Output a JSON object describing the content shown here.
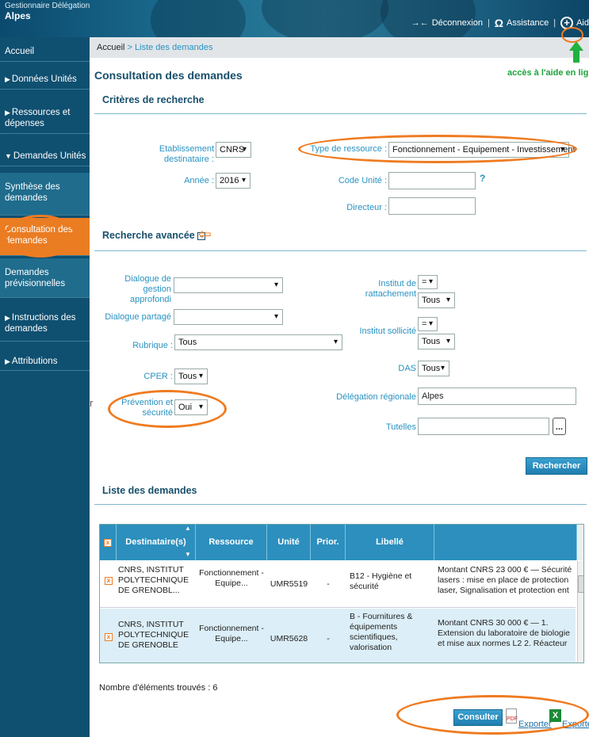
{
  "header": {
    "org_title": "Gestionnaire Délégation",
    "org_name": "Alpes",
    "logout_label": "Déconnexion",
    "assistance_label": "Assistance",
    "help_label": "Aid"
  },
  "sidebar": {
    "items": [
      {
        "label": "Accueil"
      },
      {
        "label": "Données Unités"
      },
      {
        "label": "Ressources et dépenses"
      },
      {
        "label": "Demandes Unités"
      },
      {
        "label": "Synthèse des demandes"
      },
      {
        "label": "Consultation des demandes"
      },
      {
        "label": "Demandes prévisionnelles"
      },
      {
        "label": "Instructions des demandes"
      },
      {
        "label": "Attributions"
      }
    ]
  },
  "breadcrumb": {
    "home": "Accueil",
    "sep": " > ",
    "current": "Liste des demandes"
  },
  "page_title": "Consultation des demandes",
  "help_note": "accès à l'aide en ligne",
  "criteria": {
    "title": "Critères de recherche",
    "etab_label": "Etablissement destinataire :",
    "etab_value": "CNRS",
    "type_label": "Type de ressource :",
    "type_value": "Fonctionnement - Equipement - Investissement",
    "annee_label": "Année :",
    "annee_value": "2016",
    "code_label": "Code Unité :",
    "code_value": "",
    "directeur_label": "Directeur :",
    "directeur_value": ""
  },
  "advanced": {
    "title": "Recherche avancée",
    "toggle": "−",
    "dialogue_gestion_label": "Dialogue de gestion approfondi",
    "dialogue_partage_label": "Dialogue partagé",
    "rubrique_label": "Rubrique :",
    "rubrique_value": "Tous",
    "cper_label": "CPER :",
    "cper_value": "Tous",
    "prevention_label": "Prévention et sécurité",
    "prevention_value": "Oui",
    "institut_ratt_label": "Institut de rattachement",
    "institut_ratt_op": "=",
    "institut_ratt_value": "Tous",
    "institut_soll_label": "Institut sollicité",
    "institut_soll_op": "=",
    "institut_soll_value": "Tous",
    "das_label": "DAS",
    "das_value": "Tous",
    "delegation_label": "Délégation régionale",
    "delegation_value": "Alpes",
    "tutelles_label": "Tutelles",
    "tutelles_btn": "...",
    "search_button": "Rechercher"
  },
  "list": {
    "title": "Liste des demandes",
    "columns": [
      "Destinataire(s)",
      "Ressource",
      "Unité",
      "Prior.",
      "Libellé",
      ""
    ],
    "rows": [
      {
        "dest": "CNRS, INSTITUT POLYTECHNIQUE DE GRENOBL...",
        "res": "Fonctionnement - Equipe...",
        "unit": "UMR5519",
        "prior": "-",
        "libelle": "B12 - Hygiène et sécurité",
        "desc": "Montant CNRS 23 000 € — Sécurité lasers : mise en place de protection laser, Signalisation et protection ent"
      },
      {
        "dest": "CNRS, INSTITUT POLYTECHNIQUE DE GRENOBLE",
        "res": "Fonctionnement - Equipe...",
        "unit": "UMR5628",
        "prior": "-",
        "libelle": "B - Fournitures & équipements scientifiques, valorisation",
        "desc": "Montant CNRS 30 000 € — 1. Extension du laboratoire de biologie et mise aux normes L2 2. Réacteur MOON : sui"
      }
    ],
    "count_label": "Nombre d'éléments trouvés : 6",
    "consult_button": "Consulter",
    "export_pdf": "Exporter",
    "export_xls": "Exporte"
  },
  "side_fragment": "r",
  "colors": {
    "accent": "#ef7b21",
    "sidebar": "#0f4f70",
    "title": "#174f6c",
    "link": "#2a92c2"
  }
}
